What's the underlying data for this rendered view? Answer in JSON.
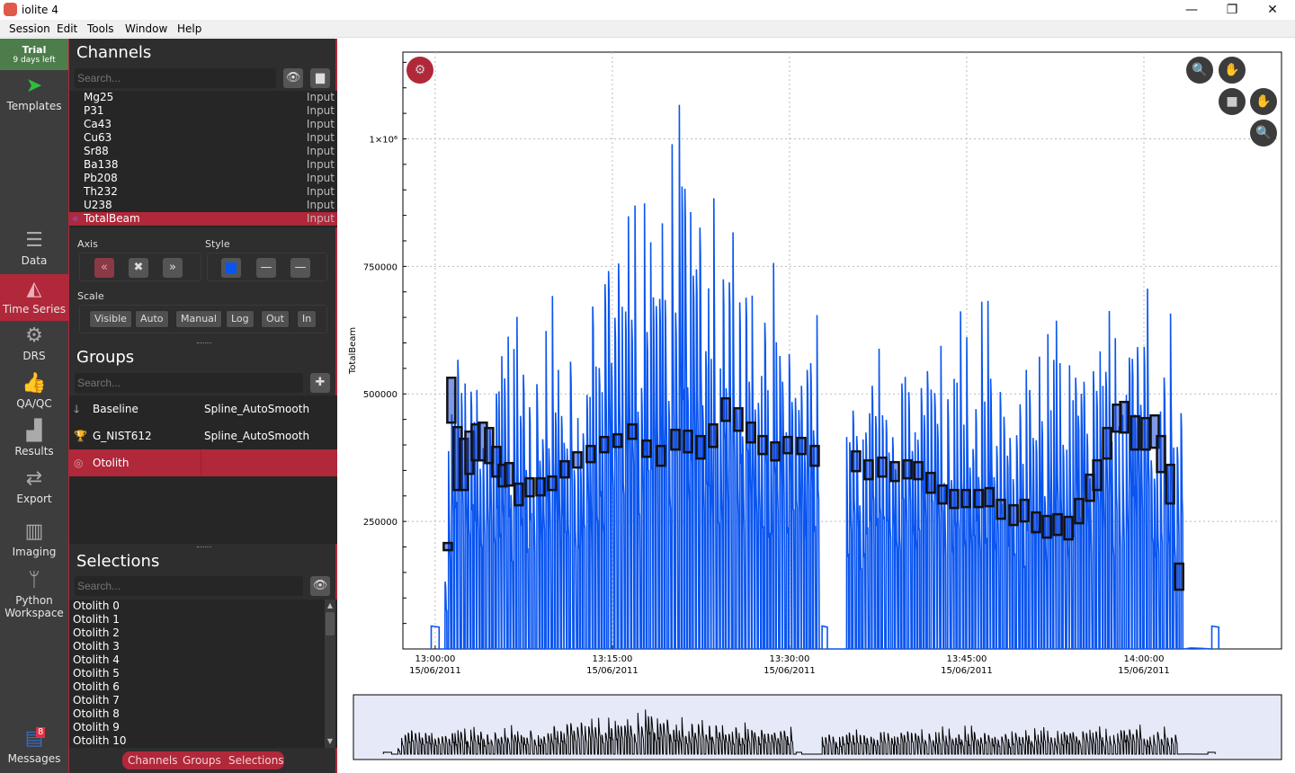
{
  "window": {
    "title": "iolite 4",
    "minimize": "—",
    "restore": "❐",
    "close": "✕"
  },
  "menu": [
    "Session",
    "Edit",
    "Tools",
    "Window",
    "Help"
  ],
  "nav": {
    "trial": {
      "title": "Trial",
      "subtitle": "9 days left"
    },
    "items": [
      {
        "label": "Templates",
        "icon": "paper-plane-icon"
      },
      {
        "label": "Data",
        "icon": "database-icon"
      },
      {
        "label": "Time Series",
        "icon": "area-chart-icon",
        "active": true
      },
      {
        "label": "DRS",
        "icon": "gear-icon"
      },
      {
        "label": "QA/QC",
        "icon": "thumbs-up-icon"
      },
      {
        "label": "Results",
        "icon": "bar-chart-icon"
      },
      {
        "label": "Export",
        "icon": "swap-arrows-icon"
      },
      {
        "label": "Imaging",
        "icon": "map-icon"
      },
      {
        "label": "Python Workspace",
        "icon": "branch-icon"
      },
      {
        "label": "Messages",
        "icon": "messages-icon",
        "badge": "8"
      }
    ]
  },
  "channels": {
    "title": "Channels",
    "search_placeholder": "Search...",
    "items": [
      {
        "name": "Mg25",
        "type": "Input"
      },
      {
        "name": "P31",
        "type": "Input"
      },
      {
        "name": "Ca43",
        "type": "Input"
      },
      {
        "name": "Cu63",
        "type": "Input"
      },
      {
        "name": "Sr88",
        "type": "Input"
      },
      {
        "name": "Ba138",
        "type": "Input"
      },
      {
        "name": "Pb208",
        "type": "Input"
      },
      {
        "name": "Th232",
        "type": "Input"
      },
      {
        "name": "U238",
        "type": "Input"
      },
      {
        "name": "TotalBeam",
        "type": "Input",
        "selected": true
      }
    ],
    "axis_label": "Axis",
    "style_label": "Style",
    "scale_label": "Scale",
    "scale_buttons": [
      "Visible",
      "Auto",
      "Manual",
      "Log",
      "Out",
      "In"
    ],
    "style_color": "#0a55f0"
  },
  "groups": {
    "title": "Groups",
    "search_placeholder": "Search...",
    "items": [
      {
        "name": "Baseline",
        "spline": "Spline_AutoSmooth",
        "icon": "arrow-down-icon"
      },
      {
        "name": "G_NIST612",
        "spline": "Spline_AutoSmooth",
        "icon": "trophy-icon"
      },
      {
        "name": "Otolith",
        "spline": "",
        "icon": "target-icon",
        "selected": true
      }
    ]
  },
  "selections": {
    "title": "Selections",
    "search_placeholder": "Search...",
    "items": [
      "Otolith 0",
      "Otolith 1",
      "Otolith 2",
      "Otolith 3",
      "Otolith 4",
      "Otolith 5",
      "Otolith 6",
      "Otolith 7",
      "Otolith 8",
      "Otolith 9",
      "Otolith 10"
    ]
  },
  "bottom_tabs": [
    "Channels",
    "Groups",
    "Selections"
  ],
  "colors": {
    "accent": "#b0283a",
    "signal": "#0a55f0",
    "trial": "#4e7d4c"
  },
  "chart_data": {
    "type": "line",
    "ylabel": "TotalBeam",
    "xlim": [
      "12:57:16",
      "14:11:39"
    ],
    "ylim": [
      0,
      1170000
    ],
    "grid": true,
    "yticks": [
      {
        "v": 250000,
        "label": "250000"
      },
      {
        "v": 500000,
        "label": "500000"
      },
      {
        "v": 750000,
        "label": "750000"
      },
      {
        "v": 1000000,
        "label": "1×10⁶"
      }
    ],
    "xticks": [
      {
        "t": "13:00:00",
        "label": "13:00:00",
        "date": "15/06/2011"
      },
      {
        "t": "13:15:00",
        "label": "13:15:00",
        "date": "15/06/2011"
      },
      {
        "t": "13:30:00",
        "label": "13:30:00",
        "date": "15/06/2011"
      },
      {
        "t": "13:45:00",
        "label": "13:45:00",
        "date": "15/06/2011"
      },
      {
        "t": "14:00:00",
        "label": "14:00:00",
        "date": "15/06/2011"
      }
    ],
    "signal_segments": [
      [
        "13:00:50",
        "13:32:30"
      ],
      [
        "13:34:50",
        "14:03:10"
      ]
    ],
    "baseline_blocks": [
      [
        "12:59:40",
        "13:00:20",
        45000
      ],
      [
        "13:32:45",
        "13:33:12",
        45000
      ],
      [
        "14:05:45",
        "14:06:20",
        45000
      ]
    ],
    "signal_peak_envelope": [
      [
        "13:00:50",
        300000
      ],
      [
        "13:01:30",
        740000
      ],
      [
        "13:05:00",
        690000
      ],
      [
        "13:08:00",
        680000
      ],
      [
        "13:11:00",
        740000
      ],
      [
        "13:13:00",
        850000
      ],
      [
        "13:15:00",
        960000
      ],
      [
        "13:18:00",
        900000
      ],
      [
        "13:21:00",
        1170000
      ],
      [
        "13:23:00",
        1000000
      ],
      [
        "13:26:00",
        930000
      ],
      [
        "13:29:00",
        800000
      ],
      [
        "13:32:30",
        700000
      ],
      [
        "13:34:50",
        600000
      ],
      [
        "13:40:00",
        720000
      ],
      [
        "13:45:00",
        720000
      ],
      [
        "13:50:00",
        640000
      ],
      [
        "13:55:00",
        700000
      ],
      [
        "14:00:00",
        760000
      ],
      [
        "14:03:10",
        680000
      ]
    ],
    "selection_boxes": [
      [
        "13:01:04",
        193700,
        207700
      ],
      [
        "13:01:22",
        443700,
        531700
      ],
      [
        "13:01:54",
        311600,
        434900
      ],
      [
        "13:02:26",
        311600,
        412000
      ],
      [
        "13:02:54",
        343300,
        426100
      ],
      [
        "13:03:26",
        369700,
        440200
      ],
      [
        "13:04:02",
        369700,
        443700
      ],
      [
        "13:04:34",
        364400,
        433100
      ],
      [
        "13:05:11",
        338000,
        396100
      ],
      [
        "13:05:43",
        318700,
        360900
      ],
      [
        "13:06:15",
        320400,
        364400
      ],
      [
        "13:07:05",
        281700,
        324000
      ],
      [
        "13:08:00",
        299300,
        334500
      ],
      [
        "13:08:55",
        301100,
        334500
      ],
      [
        "13:09:54",
        311600,
        338000
      ],
      [
        "13:10:58",
        336300,
        368000
      ],
      [
        "13:12:02",
        355600,
        385600
      ],
      [
        "13:13:10",
        366200,
        397900
      ],
      [
        "13:14:19",
        385600,
        415500
      ],
      [
        "13:15:27",
        396100,
        420800
      ],
      [
        "13:16:41",
        412000,
        440200
      ],
      [
        "13:17:54",
        376800,
        408500
      ],
      [
        "13:19:07",
        359200,
        397900
      ],
      [
        "13:20:20",
        390900,
        429600
      ],
      [
        "13:21:24",
        385600,
        427800
      ],
      [
        "13:22:28",
        373300,
        417300
      ],
      [
        "13:23:32",
        396100,
        440200
      ],
      [
        "13:24:36",
        447200,
        491200
      ],
      [
        "13:25:40",
        427800,
        471800
      ],
      [
        "13:26:44",
        404900,
        443700
      ],
      [
        "13:27:43",
        382100,
        417300
      ],
      [
        "13:28:47",
        369700,
        404900
      ],
      [
        "13:29:51",
        383800,
        415500
      ],
      [
        "13:31:00",
        382100,
        413700
      ],
      [
        "13:32:08",
        359200,
        397900
      ],
      [
        "13:35:38",
        348600,
        387300
      ],
      [
        "13:36:42",
        332800,
        369700
      ],
      [
        "13:37:51",
        338000,
        375000
      ],
      [
        "13:38:55",
        329200,
        366200
      ],
      [
        "13:39:59",
        334500,
        369700
      ],
      [
        "13:40:54",
        332800,
        366200
      ],
      [
        "13:41:57",
        306300,
        345100
      ],
      [
        "13:42:57",
        285200,
        320400
      ],
      [
        "13:43:56",
        276400,
        311600
      ],
      [
        "13:44:56",
        278200,
        311600
      ],
      [
        "13:46:00",
        278200,
        311600
      ],
      [
        "13:46:55",
        279900,
        315200
      ],
      [
        "13:47:54",
        255300,
        292300
      ],
      [
        "13:48:58",
        243000,
        281700
      ],
      [
        "13:49:53",
        250000,
        292300
      ],
      [
        "13:50:52",
        228900,
        267600
      ],
      [
        "13:51:47",
        218300,
        260600
      ],
      [
        "13:52:42",
        223600,
        264100
      ],
      [
        "13:53:37",
        214800,
        258800
      ],
      [
        "13:54:31",
        246500,
        294000
      ],
      [
        "13:55:26",
        290500,
        341600
      ],
      [
        "13:56:03",
        311600,
        369700
      ],
      [
        "13:56:53",
        373300,
        433100
      ],
      [
        "13:57:43",
        426100,
        478900
      ],
      [
        "13:58:20",
        424300,
        484200
      ],
      [
        "13:59:15",
        390900,
        456000
      ],
      [
        "14:00:09",
        390900,
        452500
      ],
      [
        "14:00:55",
        394400,
        457800
      ],
      [
        "14:01:27",
        346800,
        417300
      ],
      [
        "14:02:13",
        285200,
        360900
      ],
      [
        "14:02:59",
        116200,
        167300
      ]
    ]
  }
}
